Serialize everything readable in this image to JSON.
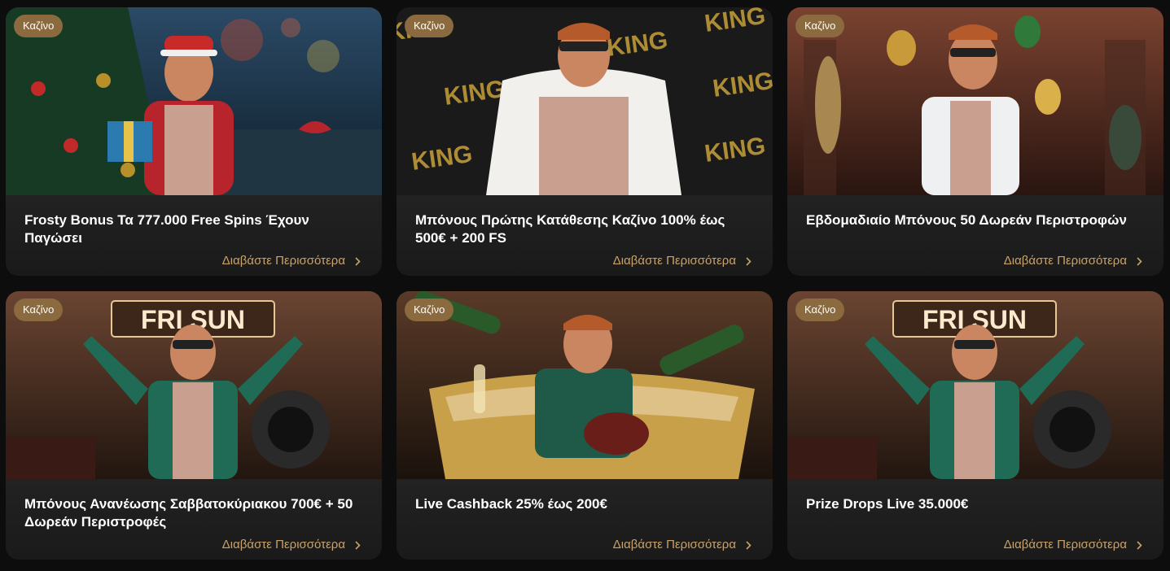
{
  "promotions": [
    {
      "badge": "Καζίνο",
      "title": "Frosty Bonus Τα 777.000 Free Spins Έχουν Παγώσει",
      "link": "Διαβάστε Περισσότερα",
      "scene": "christmas",
      "colors": {
        "bg1": "#1f3a45",
        "bg2": "#0d1c24",
        "accent": "#b8242c"
      }
    },
    {
      "badge": "Καζίνο",
      "title": "Μπόνους Πρώτης Κατάθεσης Καζίνο 100% έως 500€ + 200 FS",
      "link": "Διαβάστε Περισσότερα",
      "scene": "king",
      "bg_text": "KING",
      "colors": {
        "bg1": "#2a2a2a",
        "bg2": "#111111",
        "accent": "#c9a23a"
      }
    },
    {
      "badge": "Καζίνο",
      "title": "Εβδομαδιαίο Μπόνους 50 Δωρεάν Περιστροφών",
      "link": "Διαβάστε Περισσότερα",
      "scene": "museum",
      "colors": {
        "bg1": "#6b3a2a",
        "bg2": "#2a1510",
        "accent": "#c89a3a"
      }
    },
    {
      "badge": "Καζίνο",
      "title": "Μπόνους Ανανέωσης Σαββατοκύριακου 700€ + 50 Δωρεάν Περιστροφές",
      "link": "Διαβάστε Περισσότερα",
      "scene": "frisun",
      "sign_text": "FRI SUN",
      "colors": {
        "bg1": "#5a3a2a",
        "bg2": "#1e1410",
        "accent": "#1f6b55"
      }
    },
    {
      "badge": "Καζίνο",
      "title": "Live Cashback 25% έως 200€",
      "link": "Διαβάστε Περισσότερα",
      "scene": "bath",
      "colors": {
        "bg1": "#4a3325",
        "bg2": "#1a120c",
        "accent": "#c9a04a"
      }
    },
    {
      "badge": "Καζίνο",
      "title": "Prize Drops Live 35.000€",
      "link": "Διαβάστε Περισσότερα",
      "scene": "frisun",
      "sign_text": "FRI SUN",
      "colors": {
        "bg1": "#5a3a2a",
        "bg2": "#1e1410",
        "accent": "#1f6b55"
      }
    }
  ]
}
